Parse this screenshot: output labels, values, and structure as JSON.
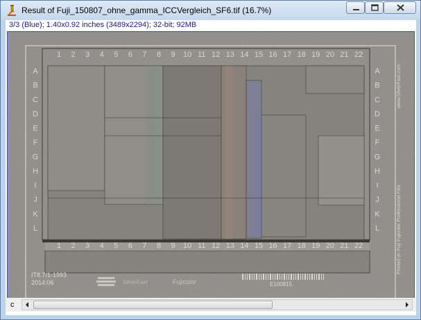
{
  "window": {
    "title": "Result of Fuji_150807_ohne_gamma_ICCVergleich_SF6.tif (16.7%)",
    "icon": "microscope-icon",
    "controls": {
      "minimize": "minimize-icon",
      "maximize": "maximize-icon",
      "close": "close-icon"
    }
  },
  "image_info": "3/3 (Blue); 1.40x0.92 inches (3489x2294); 32-bit; 92MB",
  "target": {
    "columns": [
      "1",
      "2",
      "3",
      "4",
      "5",
      "6",
      "7",
      "8",
      "9",
      "10",
      "11",
      "12",
      "13",
      "14",
      "15",
      "16",
      "17",
      "18",
      "19",
      "20",
      "21",
      "22"
    ],
    "rows": [
      "A",
      "B",
      "C",
      "D",
      "E",
      "F",
      "G",
      "H",
      "I",
      "J",
      "K",
      "L"
    ],
    "side_text_top": "www.SilverFast.com",
    "side_text_bottom": "Printed on Fuji Fujicolor Professional Film",
    "code_line1": "IT8.7/1-1993",
    "code_line2": "2014:06",
    "brand_text": "SilverFast",
    "brand_text2": "Fujicolor",
    "batch_code": "E100815"
  },
  "status": {
    "channel_letter": "c",
    "scroll_fraction": 0.65
  },
  "colors": {
    "frame": "#3b4fd0",
    "info_text": "#1a1a90",
    "title_bar": "#c4d8ee"
  }
}
